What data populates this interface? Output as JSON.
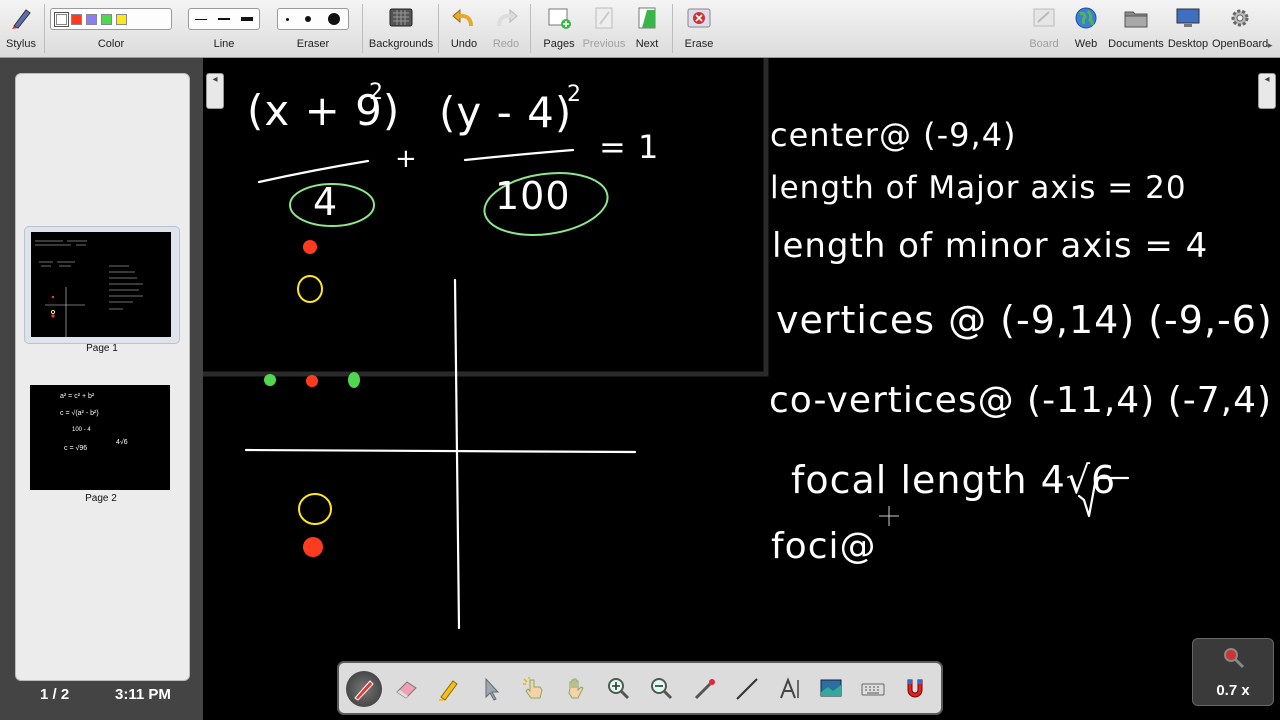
{
  "toolbar": {
    "stylus": "Stylus",
    "color": "Color",
    "line": "Line",
    "eraser": "Eraser",
    "backgrounds": "Backgrounds",
    "undo": "Undo",
    "redo": "Redo",
    "pages": "Pages",
    "previous": "Previous",
    "next": "Next",
    "erase": "Erase",
    "board": "Board",
    "web": "Web",
    "documents": "Documents",
    "desktop": "Desktop",
    "openboard": "OpenBoard"
  },
  "colors": [
    "#ffffff",
    "#ff3b1f",
    "#8b7cf7",
    "#4fd84f",
    "#ffe81a"
  ],
  "pages": [
    {
      "label": "Page 1",
      "selected": true
    },
    {
      "label": "Page 2",
      "selected": false
    }
  ],
  "status": {
    "page_count": "1 / 2",
    "time": "3:11 PM"
  },
  "board": {
    "equation": {
      "num1": "(x + 9)",
      "exp1": "2",
      "den1": "4",
      "plus": "+",
      "num2": "(y - 4)",
      "exp2": "2",
      "den2": "100",
      "equals": "= 1"
    },
    "notes": [
      "center@ (-9,4)",
      "length of Major axis = 20",
      "length of minor axis = 4",
      "vertices @ (-9,14) (-9,-6)",
      "co-vertices@ (-11,4) (-7,4)",
      "focal length 4√6",
      "foci@"
    ]
  },
  "thumb2": [
    "a² = c² + b²",
    "c = √(a² - b²)",
    "100 - 4",
    "c = √96",
    "4√6"
  ],
  "palette_tools": [
    "pen-tool",
    "eraser-tool",
    "marker-tool",
    "selector-tool",
    "interact-tool",
    "hand-tool",
    "zoom-in-tool",
    "zoom-out-tool",
    "laser-pointer-tool",
    "line-tool",
    "text-tool",
    "capture-tool",
    "keyboard-tool",
    "magnet-tool"
  ],
  "zoom": "0.7 x"
}
